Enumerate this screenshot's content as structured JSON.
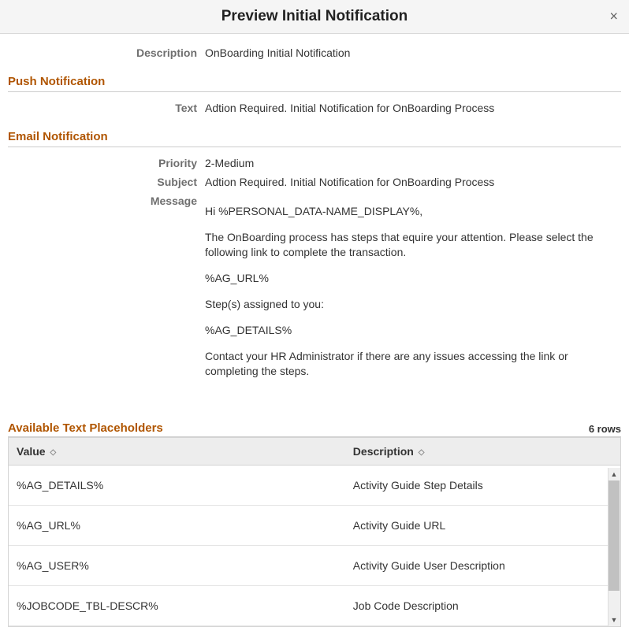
{
  "modal": {
    "title": "Preview Initial Notification"
  },
  "top": {
    "description_label": "Description",
    "description_value": "OnBoarding Initial Notification"
  },
  "push": {
    "heading": "Push Notification",
    "text_label": "Text",
    "text_value": "Adtion Required. Initial Notification for OnBoarding Process"
  },
  "email": {
    "heading": "Email Notification",
    "priority_label": "Priority",
    "priority_value": "2-Medium",
    "subject_label": "Subject",
    "subject_value": "Adtion Required. Initial Notification for OnBoarding Process",
    "message_label": "Message",
    "message_p1": "Hi %PERSONAL_DATA-NAME_DISPLAY%,",
    "message_p2": "The OnBoarding process has steps that equire your attention. Please select the following link to complete the transaction.",
    "message_p3": "%AG_URL%",
    "message_p4": "Step(s) assigned to you:",
    "message_p5": "%AG_DETAILS%",
    "message_p6": "Contact your HR Administrator if there are any issues accessing the link or completing the steps."
  },
  "placeholders": {
    "heading": "Available Text Placeholders",
    "rows_text": "6 rows",
    "col_value": "Value",
    "col_description": "Description",
    "rows": [
      {
        "value": "%AG_DETAILS%",
        "description": "Activity Guide Step Details"
      },
      {
        "value": "%AG_URL%",
        "description": "Activity Guide URL"
      },
      {
        "value": "%AG_USER%",
        "description": "Activity Guide User Description"
      },
      {
        "value": "%JOBCODE_TBL-DESCR%",
        "description": "Job Code Description"
      }
    ]
  }
}
